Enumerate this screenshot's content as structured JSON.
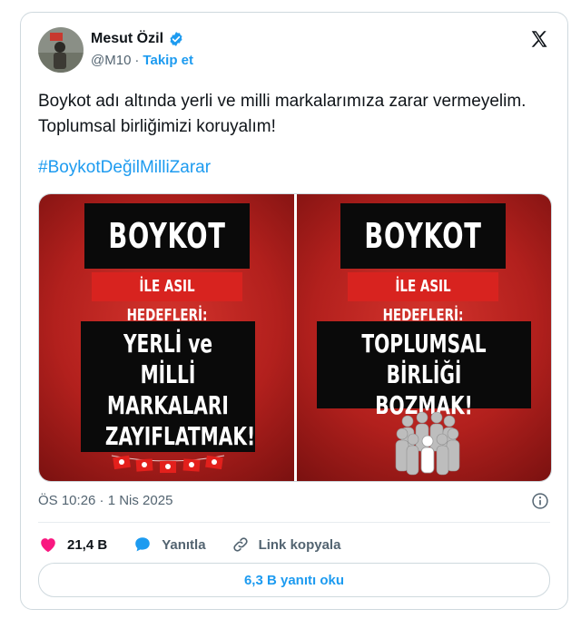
{
  "author": {
    "name": "Mesut Özil",
    "handle": "@M10",
    "separator": "·",
    "follow_label": "Takip et"
  },
  "post": {
    "text": "Boykot adı altında yerli ve milli markalarımıza zarar vermeyelim. Toplumsal birliğimizi koruyalım!",
    "hashtag": "#BoykotDeğilMilliZarar",
    "timestamp": "ÖS 10:26 · 1 Nis 2025"
  },
  "media": [
    {
      "title": "BOYKOT",
      "subtitle": "İLE ASIL HEDEFLERİ:",
      "lines": [
        "YERLİ ve MİLLİ",
        "MARKALARI",
        "ZAYIFLATMAK!"
      ]
    },
    {
      "title": "BOYKOT",
      "subtitle": "İLE ASIL HEDEFLERİ:",
      "lines": [
        "TOPLUMSAL BİRLİĞİ",
        "BOZMAK!"
      ]
    }
  ],
  "actions": {
    "likes": "21,4 B",
    "reply_label": "Yanıtla",
    "copy_link_label": "Link kopyala",
    "read_replies_label": "6,3 B yanıtı oku"
  },
  "colors": {
    "accent": "#1d9bf0",
    "like": "#f91880",
    "poster_red": "#c0261f",
    "poster_black": "#0a0a0a"
  },
  "icons": [
    "verified-badge-icon",
    "x-logo-icon",
    "info-icon",
    "heart-icon",
    "reply-bubble-icon",
    "link-icon",
    "flag-icon",
    "crowd-icon"
  ]
}
